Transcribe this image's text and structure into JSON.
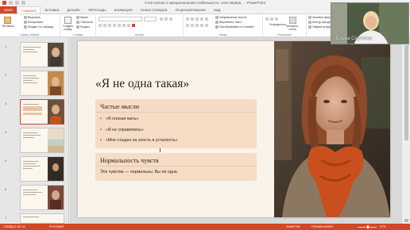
{
  "window": {
    "title": "Стоп-сигнал и эмоциональная стабильность: этап первая... - PowerPoint"
  },
  "ribbon": {
    "tabs": [
      "ФАЙЛ",
      "ГЛАВНАЯ",
      "ВСТАВКА",
      "ДИЗАЙН",
      "ПЕРЕХОДЫ",
      "АНИМАЦИЯ",
      "ПОКАЗ СЛАЙДОВ",
      "РЕЦЕНЗИРОВАНИЕ",
      "ВИД"
    ],
    "active_tab": "ГЛАВНАЯ",
    "clipboard": {
      "paste": "Вставить",
      "cut": "Вырезать",
      "copy": "Копировать",
      "format_painter": "Формат по образцу",
      "group_label": "Буфер обмена"
    },
    "slides_group": {
      "new_slide": "Создать слайд",
      "layout": "Макет",
      "reset": "Сбросить",
      "section": "Раздел",
      "group_label": "Слайды"
    },
    "font_group": {
      "group_label": "Шрифт"
    },
    "paragraph_group": {
      "text_direction": "Направление текста",
      "align_text": "Выровнять текст",
      "convert_smartart": "Преобразовать в SmartArt",
      "group_label": "Абзац"
    },
    "drawing_group": {
      "arrange": "Упорядочить",
      "quick_styles": "Экспресс-стили",
      "group_label": "Рисование"
    },
    "editing_group": {
      "fill": "Заливка фигуры",
      "outline": "Контур фигуры",
      "effects": "Эффекты фигуры"
    }
  },
  "thumbnails": [
    {
      "num": "1"
    },
    {
      "num": "2"
    },
    {
      "num": "3",
      "selected": true
    },
    {
      "num": "4"
    },
    {
      "num": "5"
    },
    {
      "num": "6"
    },
    {
      "num": "7"
    }
  ],
  "slide": {
    "title": "«Я не одна такая»",
    "card1": {
      "heading": "Частые мысли",
      "bullets": [
        "«Я плохая мать»",
        "«Я не справляюсь»",
        "«Мне стыдно за злость и усталость»"
      ]
    },
    "card2": {
      "heading": "Нормальность чувств",
      "text": "Эти чувства — нормальны. Вы не одна."
    }
  },
  "status_bar": {
    "slide_info": "СЛАЙД 3 ИЗ 13",
    "language": "РУССКИЙ",
    "notes": "ЗАМЕТКИ",
    "comments": "ПРИМЕЧАНИЯ",
    "zoom": "97%"
  },
  "webcam": {
    "name": "Елена Сергеева"
  },
  "colors": {
    "accent": "#d24726",
    "slide_bg": "#f9f3ea",
    "card_bg": "#f6dcc5"
  }
}
